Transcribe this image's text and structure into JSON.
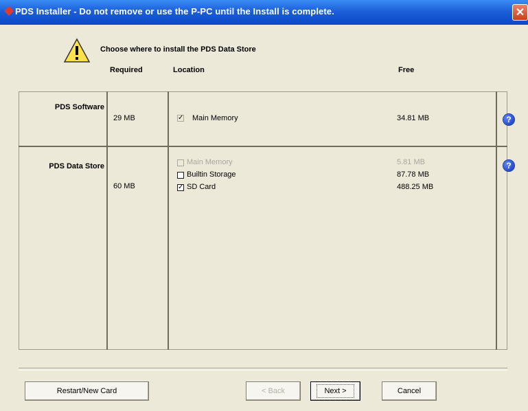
{
  "window": {
    "title": "PDS Installer - Do not remove or use the P-PC until the Install is complete."
  },
  "heading": "Choose where to install the PDS Data Store",
  "columns": {
    "required": "Required",
    "location": "Location",
    "free": "Free"
  },
  "rows": [
    {
      "label": "PDS Software",
      "required": "29 MB",
      "locations": [
        {
          "name": "Main Memory",
          "free": "34.81 MB",
          "checked": true,
          "enabled": false
        }
      ]
    },
    {
      "label": "PDS Data Store",
      "required": "60 MB",
      "locations": [
        {
          "name": "Main Memory",
          "free": "5.81 MB",
          "checked": false,
          "enabled": false
        },
        {
          "name": "Builtin Storage",
          "free": "87.78 MB",
          "checked": false,
          "enabled": true
        },
        {
          "name": "SD Card",
          "free": "488.25 MB",
          "checked": true,
          "enabled": true
        }
      ]
    }
  ],
  "buttons": {
    "restart": "Restart/New Card",
    "back": "< Back",
    "next": "Next >",
    "cancel": "Cancel"
  },
  "colors": {
    "titlebar": "#0a48c8",
    "dialog_bg": "#ece9d8",
    "close": "#c8401c"
  }
}
